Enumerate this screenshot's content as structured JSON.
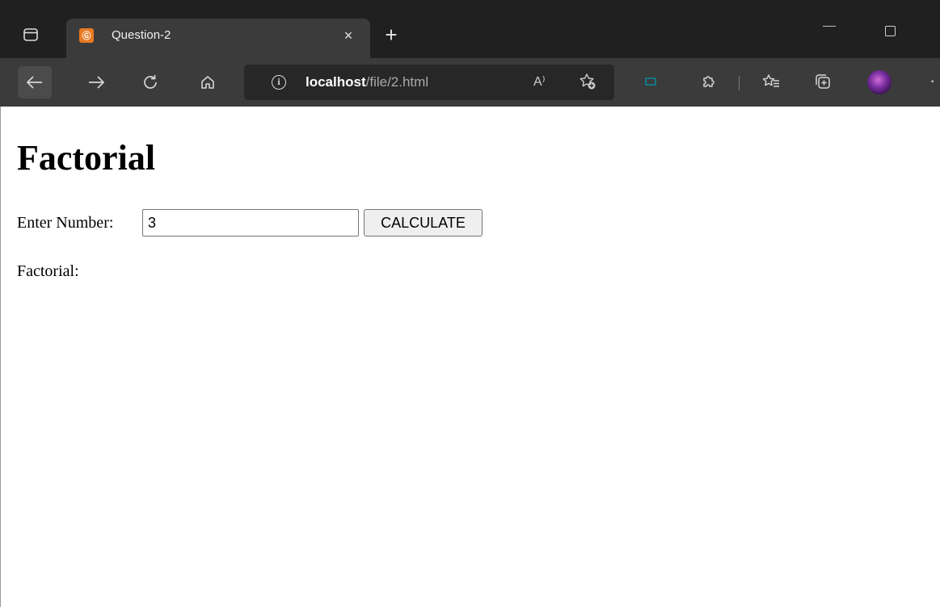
{
  "browser": {
    "tab": {
      "favicon_text": "Ⓖ",
      "title": "Question-2",
      "close_glyph": "×"
    },
    "new_tab_glyph": "+",
    "address": {
      "host": "localhost",
      "path": "/file/2.html"
    },
    "read_aloud_glyph": "A⁾",
    "icons": {
      "tab_actions": "tab-actions-icon",
      "back": "back-arrow-icon",
      "forward": "forward-arrow-icon",
      "refresh": "refresh-icon",
      "home": "home-icon",
      "info": "info-icon",
      "read_aloud": "read-aloud-icon",
      "add_favorite": "add-favorite-icon",
      "extension": "extension-icon",
      "extensions": "puzzle-icon",
      "favorites": "favorites-icon",
      "collections": "collections-icon",
      "profile": "profile-avatar",
      "more": "more-icon",
      "minimize": "minimize-icon",
      "maximize": "maximize-icon"
    },
    "colors": {
      "tabstrip": "#202020",
      "toolbar": "#3b3b3b",
      "address_bar": "#272727",
      "favicon": "#e97a22"
    }
  },
  "page": {
    "heading": "Factorial",
    "input_label": "Enter Number:",
    "input_value": "3",
    "button_label": "CALCULATE",
    "result_label": "Factorial:"
  }
}
